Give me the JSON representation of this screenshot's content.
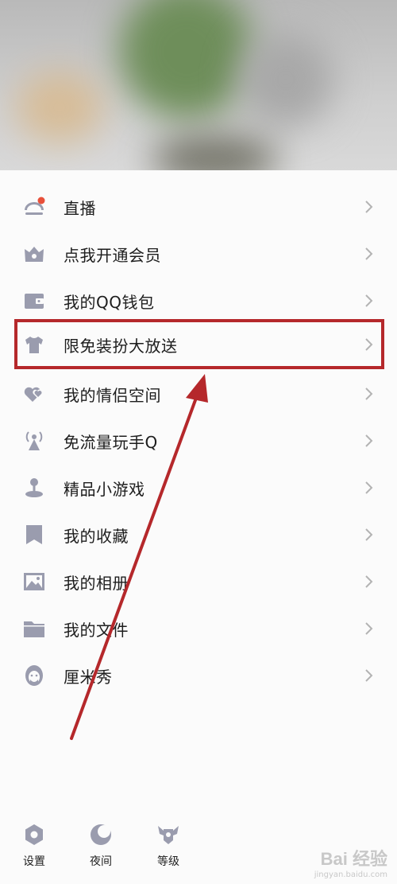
{
  "menu": {
    "items": [
      {
        "label": "直播",
        "icon": "live-icon"
      },
      {
        "label": "点我开通会员",
        "icon": "crown-icon"
      },
      {
        "label": "我的QQ钱包",
        "icon": "wallet-icon"
      },
      {
        "label": "限免装扮大放送",
        "icon": "tshirt-icon"
      },
      {
        "label": "我的情侣空间",
        "icon": "hearts-icon"
      },
      {
        "label": "免流量玩手Q",
        "icon": "signal-tower-icon"
      },
      {
        "label": "精品小游戏",
        "icon": "joystick-icon"
      },
      {
        "label": "我的收藏",
        "icon": "bookmark-icon"
      },
      {
        "label": "我的相册",
        "icon": "photo-icon"
      },
      {
        "label": "我的文件",
        "icon": "folder-icon"
      },
      {
        "label": "厘米秀",
        "icon": "avatar-face-icon"
      }
    ]
  },
  "bottom": {
    "settings": "设置",
    "night": "夜间",
    "level": "等级"
  },
  "watermark": {
    "brand": "Bai 经验",
    "url": "jingyan.baidu.com"
  },
  "colors": {
    "icon": "#9a9cae",
    "highlight": "#b5282b",
    "badge": "#e8503a"
  }
}
